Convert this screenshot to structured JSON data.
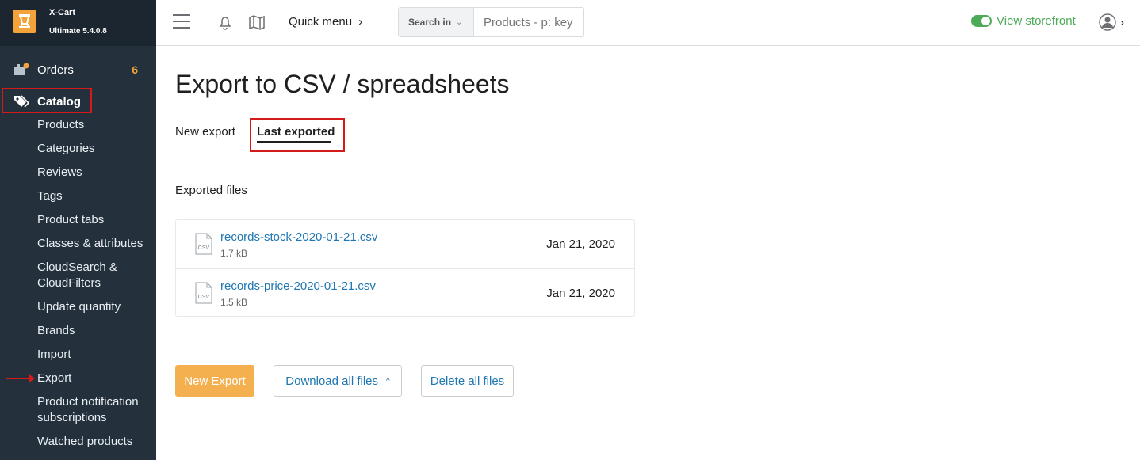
{
  "brand": {
    "name": "X-Cart",
    "version": "Ultimate 5.4.0.8"
  },
  "sidebar": {
    "orders": {
      "label": "Orders",
      "count": "6"
    },
    "catalog": {
      "label": "Catalog"
    },
    "items": [
      "Products",
      "Categories",
      "Reviews",
      "Tags",
      "Product tabs",
      "Classes & attributes",
      "CloudSearch & CloudFilters",
      "Update quantity",
      "Brands",
      "Import",
      "Export",
      "Product notification subscriptions",
      "Watched products"
    ]
  },
  "topbar": {
    "quick_menu": "Quick menu",
    "search_in": "Search in",
    "search_placeholder": "Products - p: key",
    "view_storefront": "View storefront"
  },
  "main": {
    "title": "Export to CSV / spreadsheets",
    "tabs": [
      "New export",
      "Last exported"
    ],
    "section_title": "Exported files",
    "files": [
      {
        "name": "records-stock-2020-01-21.csv",
        "size": "1.7 kB",
        "date": "Jan 21, 2020",
        "type": "CSV"
      },
      {
        "name": "records-price-2020-01-21.csv",
        "size": "1.5 kB",
        "date": "Jan 21, 2020",
        "type": "CSV"
      }
    ]
  },
  "buttons": {
    "new_export": "New Export",
    "download_all": "Download all files",
    "delete_all": "Delete all files"
  },
  "colors": {
    "sidebar_bg": "#24313d",
    "accent_orange": "#f4a23a",
    "link_blue": "#1e76b3",
    "storefront_green": "#4daa59",
    "highlight_red": "#d51a1a"
  }
}
